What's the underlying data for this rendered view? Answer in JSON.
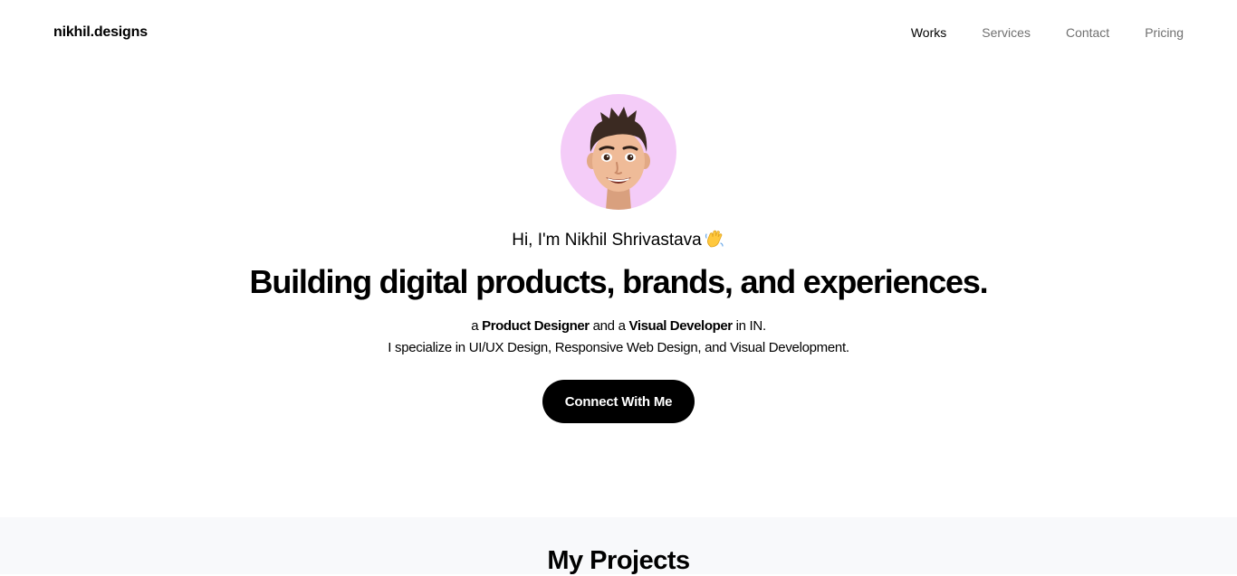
{
  "header": {
    "logo": "nikhil.designs",
    "nav": [
      {
        "label": "Works",
        "active": true
      },
      {
        "label": "Services",
        "active": false
      },
      {
        "label": "Contact",
        "active": false
      },
      {
        "label": "Pricing",
        "active": false
      }
    ]
  },
  "hero": {
    "avatar_icon": "memoji-avatar-icon",
    "avatar_bg": "#f4ccf8",
    "greeting": "Hi, I'm Nikhil Shrivastava",
    "greeting_icon": "waving-hand-icon",
    "headline": "Building digital products, brands, and experiences.",
    "role_prefix": "a ",
    "role_one": "Product Designer",
    "role_mid": " and a ",
    "role_two": "Visual Developer",
    "role_suffix": " in IN.",
    "specialties": "I specialize in UI/UX Design, Responsive Web Design, and Visual Development.",
    "cta_label": "Connect With Me"
  },
  "projects": {
    "title": "My Projects"
  },
  "colors": {
    "text": "#000000",
    "nav_inactive": "#707070",
    "cta_bg": "#000000",
    "section_bg": "#f8f9fb"
  }
}
